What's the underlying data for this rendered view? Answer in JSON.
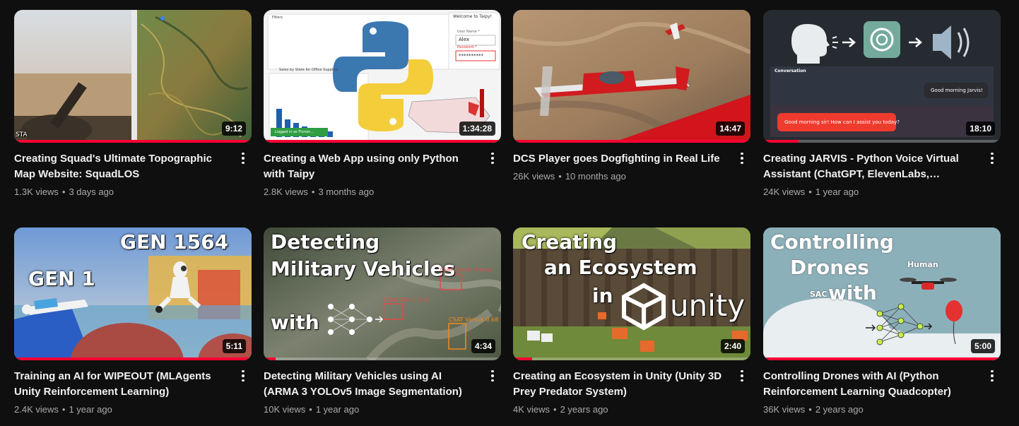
{
  "videos": [
    {
      "title": "Creating Squad's Ultimate Topographic Map Website: SquadLOS",
      "views": "1.3K views",
      "age": "3 days ago",
      "duration": "9:12",
      "progress": 1.0,
      "thumb_text": {
        "corner": "STA"
      }
    },
    {
      "title": "Creating a Web App using only Python with Taipy",
      "views": "2.8K views",
      "age": "3 months ago",
      "duration": "1:34:28",
      "progress": 1.0,
      "thumb_text": {
        "welcome": "Welcome to Taipy!",
        "user_label": "User Name *",
        "user_value": "Alex",
        "pass_label": "Password *",
        "pass_value": "**********",
        "filters": "Filters",
        "chart_title": "Sales by State for Office Supplies",
        "toast": "Logged in as Florian..."
      }
    },
    {
      "title": "DCS Player goes Dogfighting in Real Life",
      "views": "26K views",
      "age": "10 months ago",
      "duration": "14:47",
      "progress": 1.0
    },
    {
      "title": "Creating JARVIS - Python Voice Virtual Assistant (ChatGPT, ElevenLabs, Deepgram...",
      "views": "24K views",
      "age": "1 year ago",
      "duration": "18:10",
      "progress": 0.15,
      "thumb_text": {
        "conversation": "Conversation",
        "user_msg": "Good morning Jarvis!",
        "bot_msg": "Good morning sir! How can I assist you today?"
      }
    },
    {
      "title": "Training an AI for WIPEOUT (MLAgents Unity Reinforcement Learning)",
      "views": "2.4K views",
      "age": "1 year ago",
      "duration": "5:11",
      "progress": 1.0,
      "thumb_text": {
        "gen_a": "GEN 1564",
        "gen_b": "GEN 1"
      }
    },
    {
      "title": "Detecting Military Vehicles using AI (ARMA 3 YOLOv5 Image Segmentation)",
      "views": "10K views",
      "age": "1 year ago",
      "duration": "4:34",
      "progress": 0.05,
      "thumb_text": {
        "line1": "Detecting",
        "line2": "Military Vehicles",
        "line3": "with",
        "det1": "CSAT Zamak (Transp",
        "det2": "CSAT Marid 0.56",
        "det3": "CSAT Varsuk 0.68"
      }
    },
    {
      "title": "Creating an Ecosystem in Unity (Unity 3D Prey Predator System)",
      "views": "4K views",
      "age": "2 years ago",
      "duration": "2:40",
      "progress": 0.08,
      "thumb_text": {
        "line1": "Creating",
        "line2": "an Ecosystem",
        "line3": "in",
        "brand": "unity"
      }
    },
    {
      "title": "Controlling Drones with AI (Python Reinforcement Learning Quadcopter)",
      "views": "36K views",
      "age": "2 years ago",
      "duration": "5:00",
      "progress": 1.0,
      "thumb_text": {
        "line1": "Controlling",
        "line2": "Drones",
        "line3": "with",
        "human": "Human",
        "sac": "SAC"
      }
    }
  ],
  "colors": {
    "background": "#0f0f0f",
    "progress": "#ff0033",
    "meta_text": "#aaaaaa"
  }
}
